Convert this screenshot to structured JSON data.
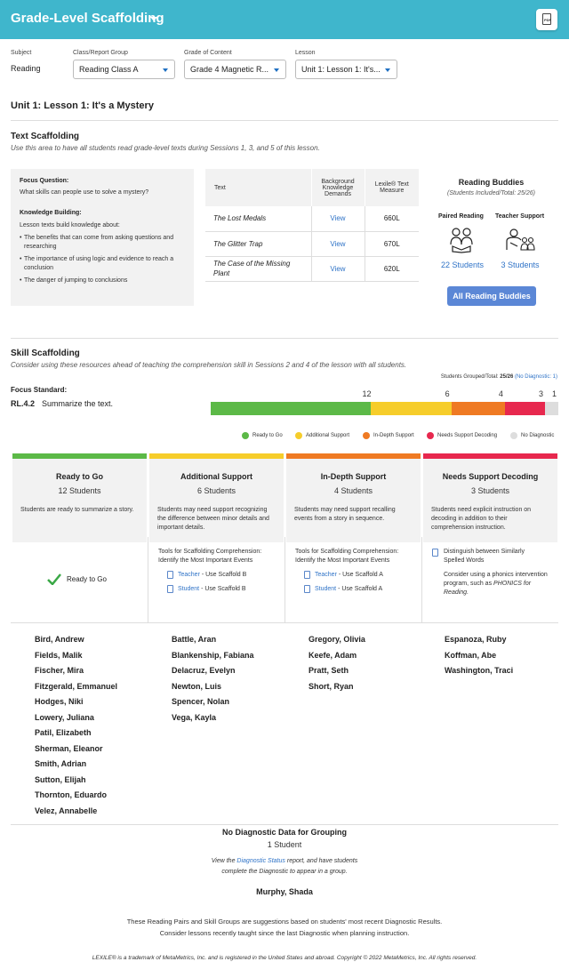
{
  "header": {
    "title": "Grade-Level Scaffolding",
    "pdf_label": "PDF"
  },
  "filters": {
    "subject_label": "Subject",
    "subject_value": "Reading",
    "class_label": "Class/Report Group",
    "class_value": "Reading Class A",
    "grade_label": "Grade of Content",
    "grade_value": "Grade 4 Magnetic R...",
    "lesson_label": "Lesson",
    "lesson_value": "Unit 1: Lesson 1: It's..."
  },
  "lesson_title": "Unit 1: Lesson 1: It's a Mystery",
  "text_scaffolding": {
    "heading": "Text Scaffolding",
    "subtitle": "Use this area to have all students read grade-level texts during Sessions 1, 3, and 5 of this lesson.",
    "focus_question_label": "Focus Question:",
    "focus_question": "What skills can people use to solve a mystery?",
    "knowledge_label": "Knowledge Building:",
    "knowledge_intro": "Lesson texts build knowledge about:",
    "bullets": [
      "The benefits that can come from asking questions and researching",
      "The importance of using logic and evidence to reach a conclusion",
      "The danger of jumping to conclusions"
    ],
    "table_headers": {
      "text": "Text",
      "demands": "Background Knowledge Demands",
      "lexile": "Lexile® Text Measure"
    },
    "rows": [
      {
        "title": "The Lost Medals",
        "link": "View",
        "lexile": "660L"
      },
      {
        "title": "The Glitter Trap",
        "link": "View",
        "lexile": "670L"
      },
      {
        "title": "The Case of the Missing Plant",
        "link": "View",
        "lexile": "620L"
      }
    ],
    "buddies": {
      "title": "Reading Buddies",
      "subtitle": "(Students Included/Total: 25/26)",
      "paired_label": "Paired Reading",
      "paired_count": "22 Students",
      "teacher_label": "Teacher Support",
      "teacher_count": "3 Students",
      "button": "All Reading Buddies"
    }
  },
  "skill_scaffolding": {
    "heading": "Skill Scaffolding",
    "subtitle": "Consider using these resources ahead of teaching the comprehension skill in Sessions 2 and 4 of the lesson with all students.",
    "grouped_prefix": "Students Grouped/Total:",
    "grouped_value": "25/26",
    "no_diag_prefix": "(No Diagnostic:",
    "no_diag_value": "1)",
    "focus_standard_label": "Focus Standard:",
    "standard_code": "RL.4.2",
    "standard_text": "Summarize the text.",
    "distribution": [
      {
        "label": "Ready to Go",
        "count": "12",
        "value": 12,
        "color": "#5cb947"
      },
      {
        "label": "Additional Support",
        "count": "6",
        "value": 6,
        "color": "#f6cd2b"
      },
      {
        "label": "In-Depth Support",
        "count": "4",
        "value": 4,
        "color": "#ef7a23"
      },
      {
        "label": "Needs Support Decoding",
        "count": "3",
        "value": 3,
        "color": "#e7284e"
      },
      {
        "label": "No Diagnostic",
        "count": "1",
        "value": 1,
        "color": "#dddddd"
      }
    ],
    "groups": [
      {
        "name": "Ready to Go",
        "count": "12 Students",
        "desc": "Students are ready to summarize a story.",
        "color": "#5cb947",
        "ready_label": "Ready to Go",
        "students": [
          "Bird, Andrew",
          "Fields, Malik",
          "Fischer, Mira",
          "Fitzgerald, Emmanuel",
          "Hodges, Niki",
          "Lowery, Juliana",
          "Patil, Elizabeth",
          "Sherman, Eleanor",
          "Smith, Adrian",
          "Sutton, Elijah",
          "Thornton, Eduardo",
          "Velez, Annabelle"
        ]
      },
      {
        "name": "Additional Support",
        "count": "6 Students",
        "desc": "Students may need support recognizing the difference between minor details and important details.",
        "color": "#f6cd2b",
        "tools_title": "Tools for Scaffolding Comprehension: Identify the Most Important Events",
        "teacher_link": "Teacher",
        "teacher_suffix": " - Use Scaffold B",
        "student_link": "Student",
        "student_suffix": " - Use Scaffold B",
        "students": [
          "Battle, Aran",
          "Blankenship, Fabiana",
          "Delacruz, Evelyn",
          "Newton, Luis",
          "Spencer, Nolan",
          "Vega, Kayla"
        ]
      },
      {
        "name": "In-Depth Support",
        "count": "4 Students",
        "desc": "Students may need support recalling events from a story in sequence.",
        "color": "#ef7a23",
        "tools_title": "Tools for Scaffolding Comprehension: Identify the Most Important Events",
        "teacher_link": "Teacher",
        "teacher_suffix": " - Use Scaffold A",
        "student_link": "Student",
        "student_suffix": " - Use Scaffold A",
        "students": [
          "Gregory, Olivia",
          "Keefe, Adam",
          "Pratt, Seth",
          "Short, Ryan"
        ]
      },
      {
        "name": "Needs Support Decoding",
        "count": "3 Students",
        "desc": "Students need explicit instruction on decoding in addition to their comprehension instruction.",
        "color": "#e7284e",
        "resource_link": "Distinguish between Similarly Spelled Words",
        "phonics_text": "Consider using a phonics intervention program, such as",
        "phonics_name": "PHONICS for Reading.",
        "students": [
          "Espanoza, Ruby",
          "Koffman, Abe",
          "Washington, Traci"
        ]
      }
    ],
    "no_diagnostic": {
      "title": "No Diagnostic Data for Grouping",
      "count": "1 Student",
      "view_prefix": "View the",
      "view_link": "Diagnostic Status",
      "view_suffix": "report, and have students",
      "view_line2": "complete the Diagnostic to appear in a group.",
      "student": "Murphy, Shada"
    }
  },
  "footer": {
    "note_line1": "These Reading Pairs and Skill Groups are suggestions based on students' most recent Diagnostic Results.",
    "note_line2": "Consider lessons recently taught since the last Diagnostic when planning instruction.",
    "trademark": "LEXILE® is a trademark of MetaMetrics, Inc. and is registered in the United States and abroad. Copyright © 2022 MetaMetrics, Inc. All rights reserved."
  }
}
